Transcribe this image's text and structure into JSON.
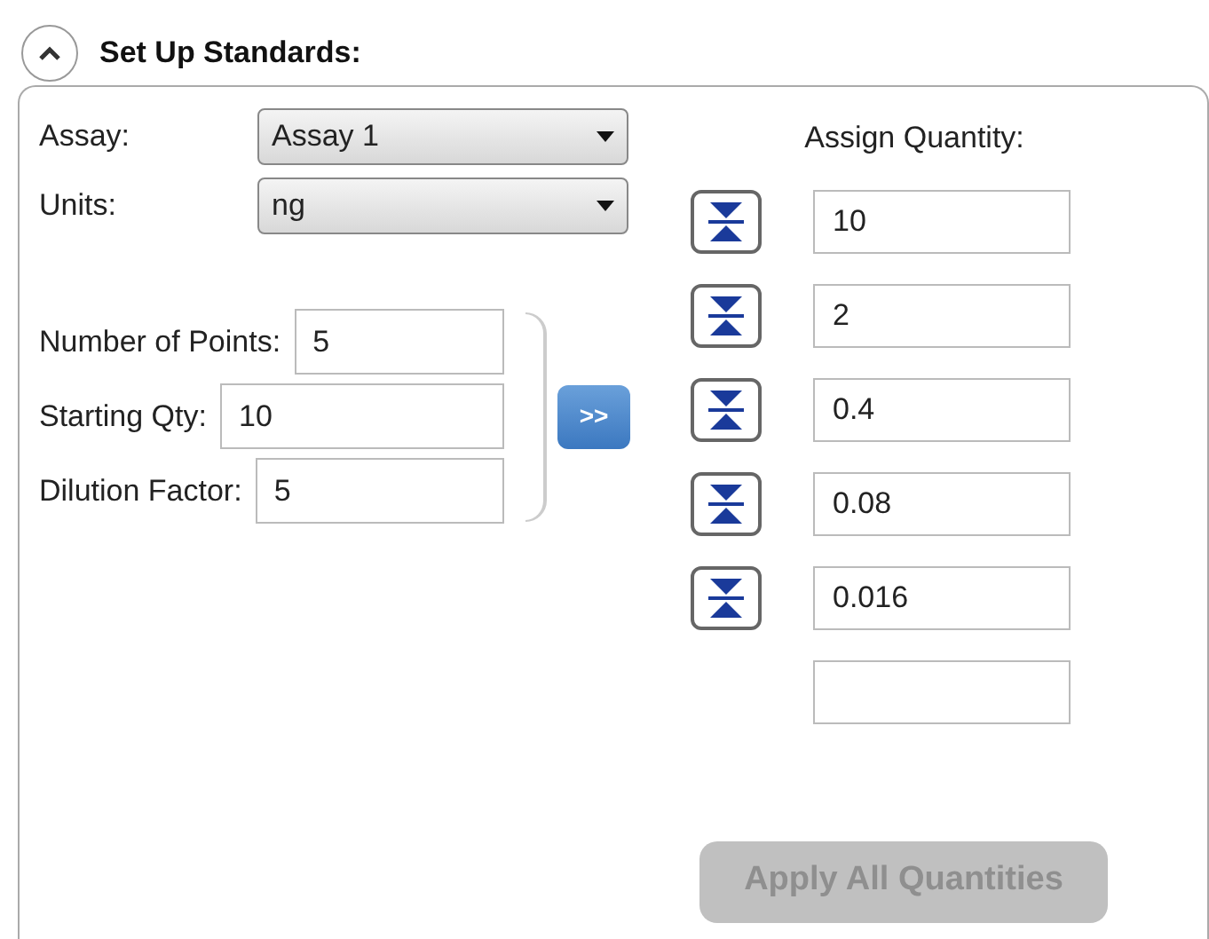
{
  "section": {
    "title": "Set Up Standards:",
    "expanded": true
  },
  "assay": {
    "label": "Assay:",
    "value": "Assay 1"
  },
  "units": {
    "label": "Units:",
    "value": "ng"
  },
  "series": [
    {
      "label": "Number of Points:",
      "value": "5"
    },
    {
      "label": "Starting Qty:",
      "value": "10"
    },
    {
      "label": "Dilution Factor:",
      "value": "5"
    }
  ],
  "fill_button": {
    "label": ">>"
  },
  "assign": {
    "title": "Assign Quantity:",
    "rows": [
      {
        "kind": "with-button",
        "value": "10"
      },
      {
        "kind": "with-button",
        "value": "2"
      },
      {
        "kind": "with-button",
        "value": "0.4"
      },
      {
        "kind": "with-button",
        "value": "0.08"
      },
      {
        "kind": "with-button",
        "value": "0.016"
      },
      {
        "kind": "plain"
      }
    ]
  },
  "apply_button": {
    "label": "Apply All Quantities",
    "disabled": true
  }
}
